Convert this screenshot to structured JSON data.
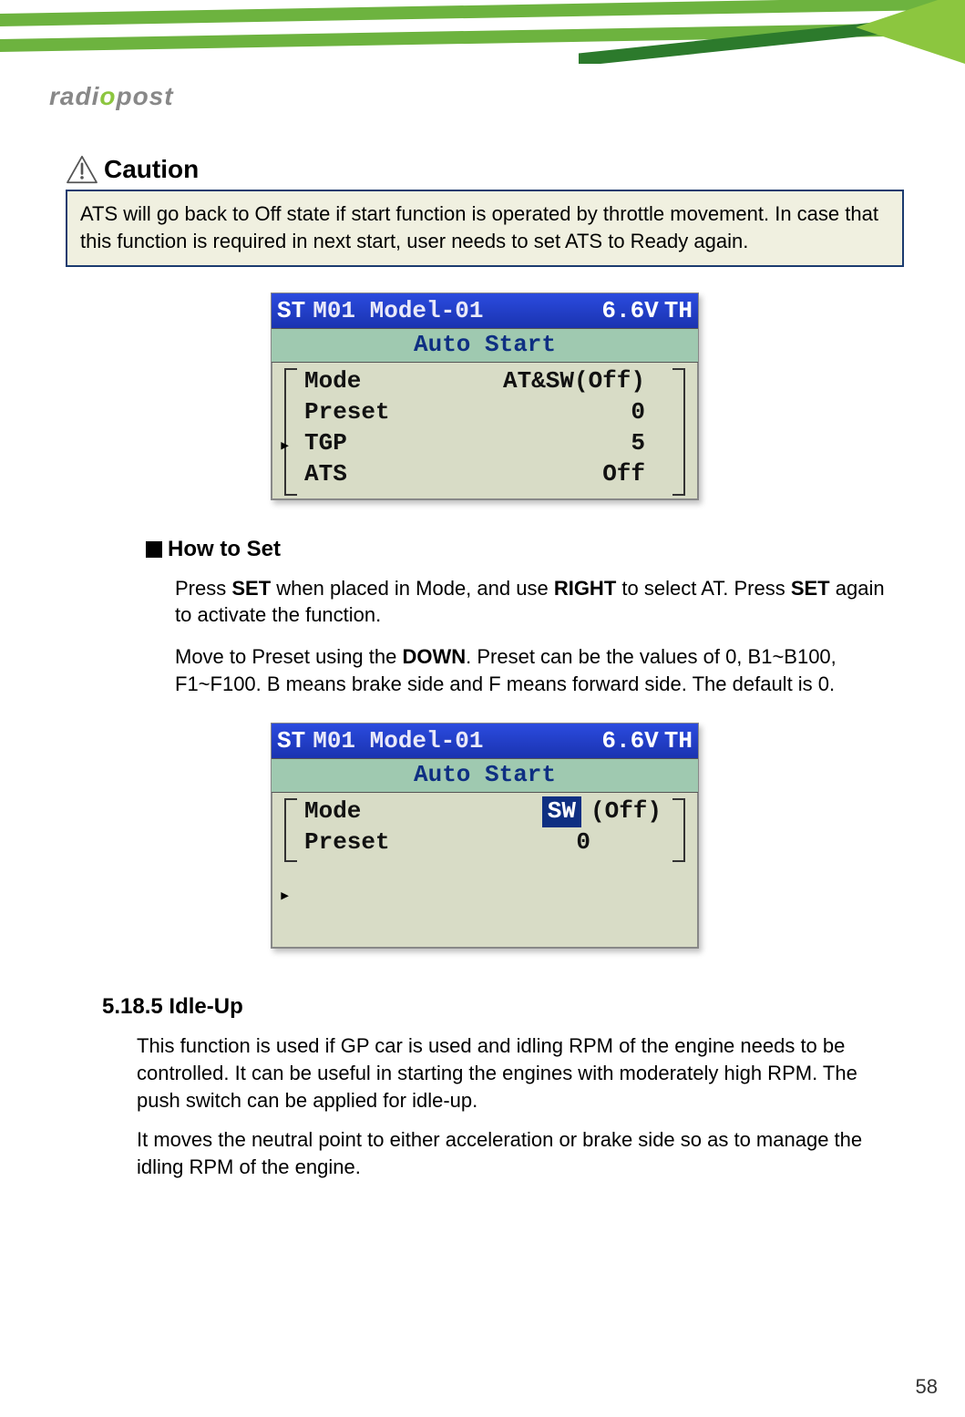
{
  "logo_prefix": "radi",
  "logo_accent": "o",
  "logo_suffix": "post",
  "caution": {
    "heading": "Caution",
    "body": "ATS will go back to Off state if start function is operated by throttle movement. In case that this function is required in next start, user needs to set ATS to Ready again."
  },
  "screenshot1": {
    "st": "ST",
    "model": "M01 Model-01",
    "voltage": "6.6V",
    "th": "TH",
    "subtitle": "Auto Start",
    "rows": [
      {
        "k": "Mode",
        "v": "AT&SW(Off)"
      },
      {
        "k": "Preset",
        "v": "0"
      },
      {
        "k": "TGP",
        "v": "5"
      },
      {
        "k": "ATS",
        "v": "Off"
      }
    ]
  },
  "howto": {
    "heading": "How to Set",
    "p1_pre": "Press ",
    "p1_b1": "SET",
    "p1_mid1": " when placed in Mode, and use ",
    "p1_b2": "RIGHT",
    "p1_mid2": " to select AT. Press ",
    "p1_b3": "SET",
    "p1_post": " again to activate the function.",
    "p2_pre": "Move to Preset using the ",
    "p2_b1": "DOWN",
    "p2_post": ". Preset can be the values of 0, B1~B100, F1~F100. B means brake side and F means forward side. The default is 0."
  },
  "screenshot2": {
    "st": "ST",
    "model": "M01 Model-01",
    "voltage": "6.6V",
    "th": "TH",
    "subtitle": "Auto Start",
    "mode_label": "Mode",
    "mode_value_hl": "SW",
    "mode_value_tail": "(Off)",
    "preset_label": "Preset",
    "preset_value": "0"
  },
  "section": {
    "heading": "5.18.5 Idle-Up",
    "p1": "This function is used if GP car is used and idling RPM of the engine needs to be controlled.  It can be useful in starting the engines with moderately high RPM. The push switch can be applied for idle-up.",
    "p2": "It moves the neutral point to either acceleration or brake side so as to manage the idling RPM of the engine."
  },
  "page_number": "58"
}
